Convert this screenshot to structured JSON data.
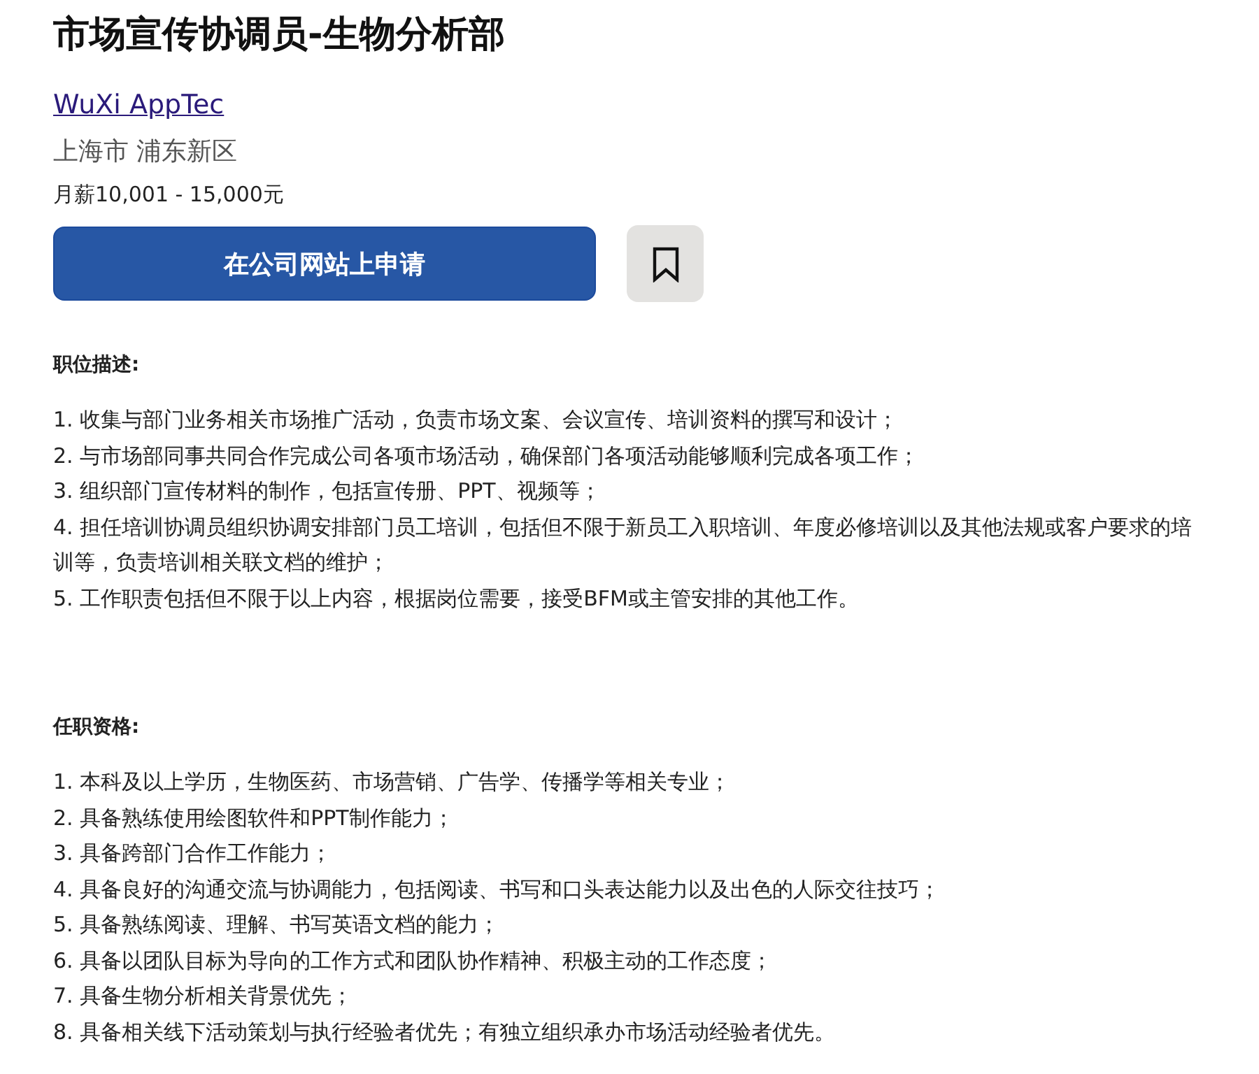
{
  "job": {
    "title": "市场宣传协调员-生物分析部",
    "company": "WuXi AppTec",
    "location": "上海市 浦东新区",
    "salary": "月薪10,001 - 15,000元"
  },
  "actions": {
    "apply": "在公司网站上申请",
    "saved": false
  },
  "sections": [
    {
      "heading": "职位描述:",
      "items": [
        "1. 收集与部门业务相关市场推广活动，负责市场文案、会议宣传、培训资料的撰写和设计；",
        "2. 与市场部同事共同合作完成公司各项市场活动，确保部门各项活动能够顺利完成各项工作；",
        "3. 组织部门宣传材料的制作，包括宣传册、PPT、视频等；",
        "4. 担任培训协调员组织协调安排部门员工培训，包括但不限于新员工入职培训、年度必修培训以及其他法规或客户要求的培训等，负责培训相关联文档的维护；",
        "5. 工作职责包括但不限于以上内容，根据岗位需要，接受BFM或主管安排的其他工作。"
      ]
    },
    {
      "heading": "任职资格:",
      "items": [
        "1. 本科及以上学历，生物医药、市场营销、广告学、传播学等相关专业；",
        "2. 具备熟练使用绘图软件和PPT制作能力；",
        "3. 具备跨部门合作工作能力；",
        "4. 具备良好的沟通交流与协调能力，包括阅读、书写和口头表达能力以及出色的人际交往技巧；",
        "5. 具备熟练阅读、理解、书写英语文档的能力；",
        "6. 具备以团队目标为导向的工作方式和团队协作精神、积极主动的工作态度；",
        "7. 具备生物分析相关背景优先；",
        "8. 具备相关线下活动策划与执行经验者优先；有独立组织承办市场活动经验者优先。"
      ]
    }
  ]
}
